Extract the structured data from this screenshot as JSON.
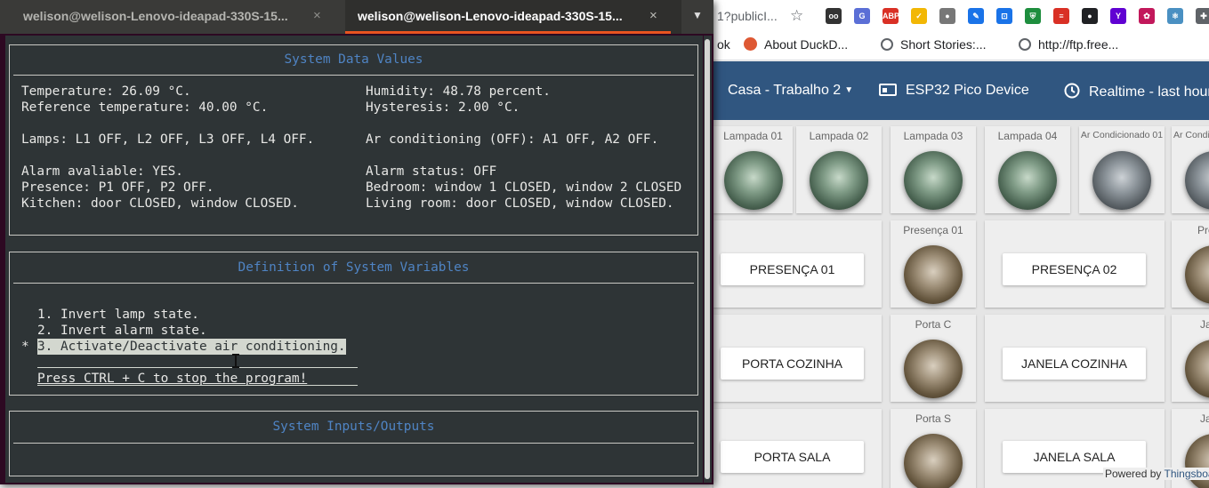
{
  "browser": {
    "url_fragment": "1?publicI...",
    "bookmarks": [
      "ok",
      "About DuckD...",
      "Short Stories:...",
      "http://ftp.free..."
    ],
    "extensions": [
      {
        "name": "cookie-icon",
        "color": "#333333",
        "glyph": "oo"
      },
      {
        "name": "translate-icon",
        "color": "#5b6fd6",
        "glyph": "G"
      },
      {
        "name": "adblock-icon",
        "color": "#d93025",
        "glyph": "ABP"
      },
      {
        "name": "shield-extension-icon",
        "color": "#f2b705",
        "glyph": "✓"
      },
      {
        "name": "rabbit-icon",
        "color": "#777777",
        "glyph": "●"
      },
      {
        "name": "pen-icon",
        "color": "#1a73e8",
        "glyph": "✎"
      },
      {
        "name": "crop-icon",
        "color": "#1a73e8",
        "glyph": "⊡"
      },
      {
        "name": "green-shield-icon",
        "color": "#1e8e3e",
        "glyph": "⛨"
      },
      {
        "name": "reader-icon",
        "color": "#d93025",
        "glyph": "≡"
      },
      {
        "name": "bullet-icon",
        "color": "#202124",
        "glyph": "●"
      },
      {
        "name": "yahoo-icon",
        "color": "#6001d2",
        "glyph": "Y"
      },
      {
        "name": "color-icon",
        "color": "#c2185b",
        "glyph": "✿"
      },
      {
        "name": "react-icon",
        "color": "#4a90c2",
        "glyph": "⚛"
      },
      {
        "name": "puzzle-icon",
        "color": "#5f6368",
        "glyph": "✚"
      }
    ]
  },
  "thingsboard": {
    "header": {
      "dashboard_select": "Casa - Trabalho 2",
      "device_label": "ESP32 Pico Device",
      "time_window": "Realtime - last hour"
    },
    "row1_labels": [
      "Lampada 01",
      "Lampada 02",
      "Lampada 03",
      "Lampada 04",
      "Ar Condicionado 01",
      "Ar Condi"
    ],
    "row2": {
      "btn1": "PRESENÇA 01",
      "label1": "Presença 01",
      "btn2": "PRESENÇA 02",
      "label2": "Prese"
    },
    "row3": {
      "btn1": "PORTA COZINHA",
      "label1": "Porta C",
      "btn2": "JANELA COZINHA",
      "label2": "Jan"
    },
    "row4": {
      "btn1": "PORTA SALA",
      "label1": "Porta S",
      "btn2": "JANELA SALA",
      "label2": "Jan"
    },
    "powered_prefix": "Powered by",
    "powered_brand": "Thingsboard"
  },
  "terminal": {
    "tabs": [
      {
        "title": "welison@welison-Lenovo-ideapad-330S-15...",
        "active": false
      },
      {
        "title": "welison@welison-Lenovo-ideapad-330S-15...",
        "active": true
      }
    ],
    "close_glyph": "×",
    "menu_glyph": "▼",
    "data_panel": {
      "title": "System Data Values",
      "left": [
        "Temperature: 26.09 °C.",
        "Reference temperature: 40.00 °C.",
        "",
        "Lamps: L1 OFF, L2 OFF, L3 OFF, L4 OFF.",
        "",
        "Alarm avaliable: YES.",
        "Presence: P1 OFF, P2 OFF.",
        "Kitchen: door CLOSED, window CLOSED."
      ],
      "right": [
        "Humidity: 48.78 percent.",
        "Hysteresis: 2.00 °C.",
        "",
        "Ar conditioning (OFF): A1 OFF, A2 OFF.",
        "",
        "Alarm status: OFF",
        "Bedroom: window 1 CLOSED, window 2 CLOSED",
        "Living room: door CLOSED, window CLOSED."
      ]
    },
    "definition_panel": {
      "title": "Definition of System Variables",
      "options": [
        "1. Invert lamp state.",
        "2. Invert alarm state.",
        "3. Activate/Deactivate air conditioning."
      ],
      "selected_marker": "*",
      "selected_index": 2,
      "footer": "Press CTRL + C to stop the program!"
    },
    "io_panel": {
      "title": "System Inputs/Outputs"
    }
  }
}
